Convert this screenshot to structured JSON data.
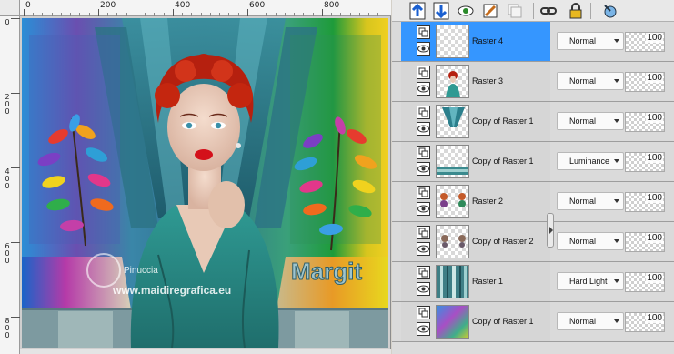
{
  "rulers": {
    "top_labels": [
      "0",
      "200",
      "400",
      "600",
      "800"
    ],
    "left_labels": [
      [
        "0"
      ],
      [
        "2",
        "0",
        "0"
      ],
      [
        "4",
        "0",
        "0"
      ],
      [
        "6",
        "0",
        "0"
      ],
      [
        "8",
        "0",
        "0"
      ]
    ]
  },
  "canvas": {
    "watermark_name": "Pinuccia",
    "watermark_site": "www.maidiregrafica.eu",
    "signature": "Margit"
  },
  "toolbar": {
    "icons": [
      "new-layer-up-icon",
      "merge-down-icon",
      "view-layer-icon",
      "edit-mask-icon",
      "duplicate-icon",
      "link-icon",
      "lock-icon",
      "reset-icon"
    ]
  },
  "layers": [
    {
      "name": "Raster 4",
      "blend": "Normal",
      "opacity": "100",
      "selected": true
    },
    {
      "name": "Raster 3",
      "blend": "Normal",
      "opacity": "100",
      "selected": false
    },
    {
      "name": "Copy of Raster 1",
      "blend": "Normal",
      "opacity": "100",
      "selected": false
    },
    {
      "name": "Copy of Raster 1",
      "blend": "Luminance",
      "opacity": "100",
      "selected": false
    },
    {
      "name": "Raster 2",
      "blend": "Normal",
      "opacity": "100",
      "selected": false
    },
    {
      "name": "Copy of Raster 2",
      "blend": "Normal",
      "opacity": "100",
      "selected": false
    },
    {
      "name": "Raster 1",
      "blend": "Hard Light",
      "opacity": "100",
      "selected": false
    },
    {
      "name": "Copy of Raster 1",
      "blend": "Normal",
      "opacity": "100",
      "selected": false
    }
  ],
  "colors": {
    "selected_row": "#3596ff",
    "panel_bg": "#dcdcdc"
  }
}
